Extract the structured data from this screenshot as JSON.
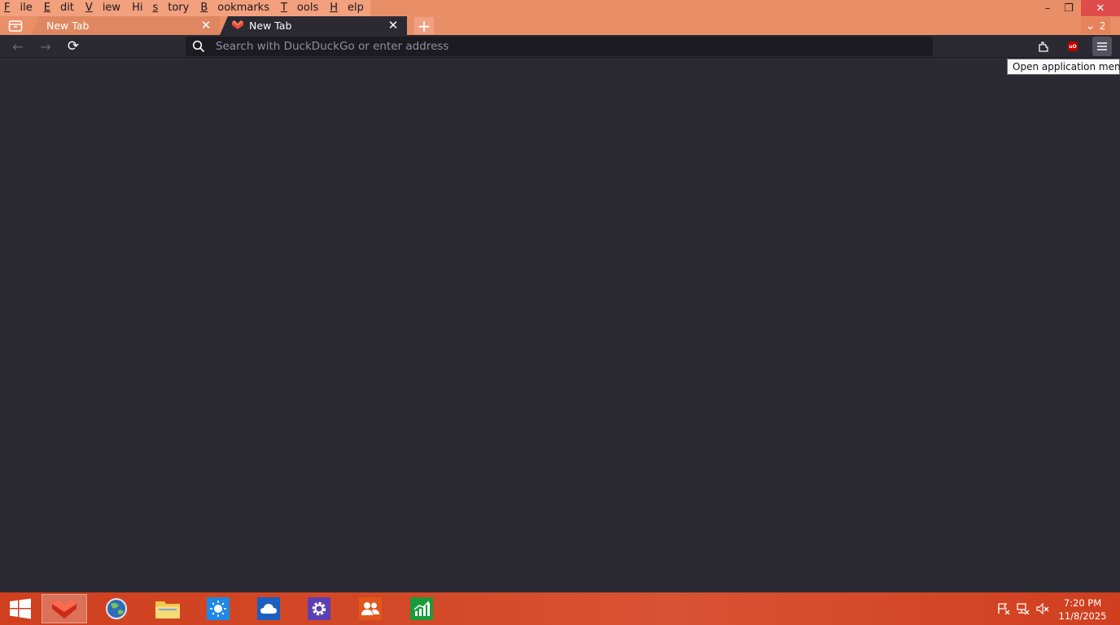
{
  "menu": {
    "items": [
      {
        "accel": "F",
        "rest": "ile"
      },
      {
        "accel": "E",
        "rest": "dit"
      },
      {
        "accel": "V",
        "rest": "iew"
      },
      {
        "pre": "Hi",
        "accel": "s",
        "rest": "tory"
      },
      {
        "accel": "B",
        "rest": "ookmarks"
      },
      {
        "accel": "T",
        "rest": "ools"
      },
      {
        "accel": "H",
        "rest": "elp"
      }
    ]
  },
  "window_controls": {
    "minimize": "–",
    "restore": "❐",
    "close": "✕"
  },
  "tabs": [
    {
      "title": "New Tab",
      "active": false,
      "close": "✕"
    },
    {
      "title": "New Tab",
      "active": true,
      "close": "✕"
    }
  ],
  "new_tab_label": "+",
  "all_tabs": {
    "chevron": "⌄",
    "count": "2"
  },
  "nav": {
    "back": "←",
    "forward": "→",
    "reload": "⟳"
  },
  "urlbar": {
    "placeholder": "Search with DuckDuckGo or enter address",
    "value": ""
  },
  "toolbar": {
    "extensions_icon": "puzzle-icon",
    "ublock_label": "uO",
    "menu_icon": "hamburger-icon"
  },
  "tooltip": "Open application menu",
  "taskbar": {
    "apps": [
      {
        "name": "firefox-dev",
        "color": "#d6311f",
        "active": true
      },
      {
        "name": "earth",
        "color": "#3a7bd5",
        "active": false
      },
      {
        "name": "file-explorer",
        "color": "#f3c742",
        "active": false
      },
      {
        "name": "weather",
        "color": "#1f88e5",
        "active": false
      },
      {
        "name": "onedrive",
        "color": "#1b5fbf",
        "active": false
      },
      {
        "name": "settings",
        "color": "#5b3fb4",
        "active": false
      },
      {
        "name": "people",
        "color": "#e0561b",
        "active": false
      },
      {
        "name": "finance",
        "color": "#1a9b3a",
        "active": false
      }
    ],
    "clock_time": "7:20 PM",
    "clock_date": "11/8/2025"
  }
}
